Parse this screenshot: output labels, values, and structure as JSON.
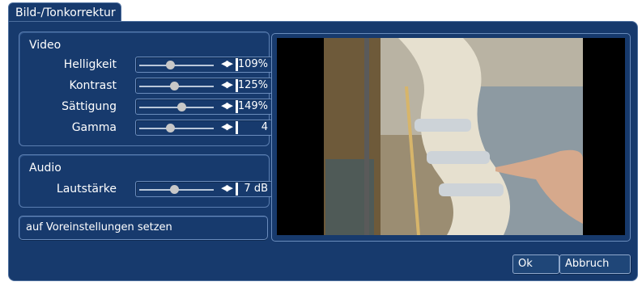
{
  "dialog": {
    "title": "Bild-/Tonkorrektur"
  },
  "video": {
    "title": "Video",
    "rows": [
      {
        "label": "Helligkeit",
        "value": "109%",
        "level": 0.4
      },
      {
        "label": "Kontrast",
        "value": "125%",
        "level": 0.46
      },
      {
        "label": "Sättigung",
        "value": "149%",
        "level": 0.55
      },
      {
        "label": "Gamma",
        "value": "4",
        "level": 0.4
      }
    ]
  },
  "audio": {
    "title": "Audio",
    "rows": [
      {
        "label": "Lautstärke",
        "value": "7 dB",
        "level": 0.46
      }
    ]
  },
  "reset_button": "auf Voreinstellungen setzen",
  "buttons": {
    "ok": "Ok",
    "cancel": "Abbruch"
  },
  "colors": {
    "background": "#173a6d",
    "border": "#5b7eb0",
    "text": "#ffffff"
  }
}
